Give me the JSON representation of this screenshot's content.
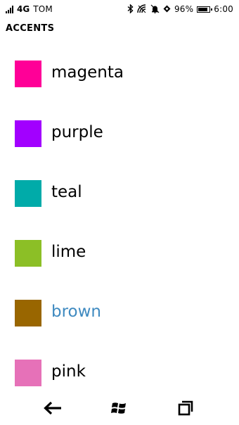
{
  "status_bar": {
    "network": "4G",
    "carrier": "TOM",
    "battery_percent": "96%",
    "time": "6:00",
    "icons": [
      "signal-icon",
      "bluetooth-icon",
      "wifi-icon",
      "quiet-hours-icon",
      "location-icon",
      "battery-icon"
    ]
  },
  "page": {
    "title": "ACCENTS"
  },
  "accents": [
    {
      "label": "magenta",
      "color": "#ff0097",
      "selected": false
    },
    {
      "label": "purple",
      "color": "#a200ff",
      "selected": false
    },
    {
      "label": "teal",
      "color": "#00aba9",
      "selected": false
    },
    {
      "label": "lime",
      "color": "#8cbf26",
      "selected": false
    },
    {
      "label": "brown",
      "color": "#996600",
      "selected": true
    },
    {
      "label": "pink",
      "color": "#e671b8",
      "selected": false
    }
  ],
  "selected_text_color": "#3f8ac0",
  "navigation": {
    "icons": [
      "back-arrow-icon",
      "windows-start-icon",
      "multitask-icon"
    ]
  }
}
